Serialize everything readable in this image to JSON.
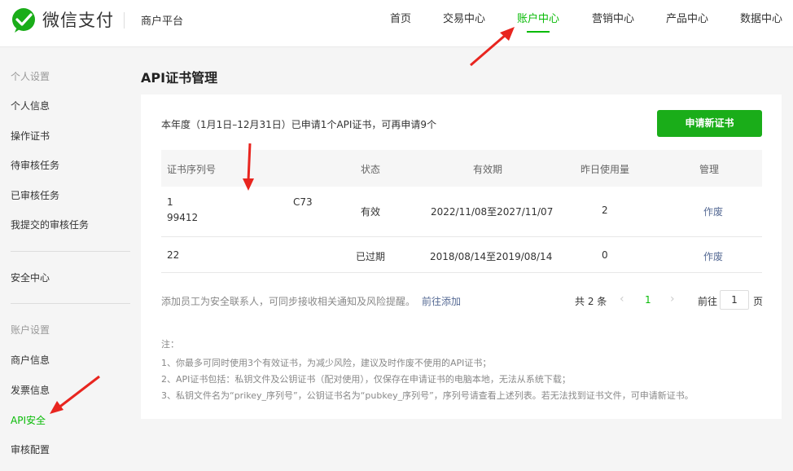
{
  "header": {
    "brand": "微信支付",
    "platform": "商户平台",
    "nav": [
      {
        "label": "首页",
        "active": false
      },
      {
        "label": "交易中心",
        "active": false
      },
      {
        "label": "账户中心",
        "active": true
      },
      {
        "label": "营销中心",
        "active": false
      },
      {
        "label": "产品中心",
        "active": false
      },
      {
        "label": "数据中心",
        "active": false
      }
    ]
  },
  "sidebar": {
    "group1_title": "个人设置",
    "group1_items": [
      "个人信息",
      "操作证书",
      "待审核任务",
      "已审核任务",
      "我提交的审核任务"
    ],
    "security_center": "安全中心",
    "group2_title": "账户设置",
    "group2_items": [
      "商户信息",
      "发票信息",
      "API安全",
      "审核配置"
    ],
    "active_item": "API安全"
  },
  "main": {
    "title": "API证书管理",
    "quota_text": "本年度（1月1日–12月31日）已申请1个API证书，可再申请9个",
    "apply_button": "申请新证书",
    "table": {
      "columns": [
        "证书序列号",
        "状态",
        "有效期",
        "昨日使用量",
        "管理"
      ],
      "rows": [
        {
          "serial_line1": "1",
          "serial_line1_end": "C73",
          "serial_line2": "99412",
          "status": "有效",
          "validity": "2022/11/08至2027/11/07",
          "usage": "2",
          "action": "作废"
        },
        {
          "serial_line1": "22",
          "status": "已过期",
          "validity": "2018/08/14至2019/08/14",
          "usage": "0",
          "action": "作废"
        }
      ]
    },
    "contact_tip": "添加员工为安全联系人，可同步接收相关通知及风险提醒。",
    "contact_link": "前往添加",
    "pagination": {
      "total_text": "共 2 条",
      "prev": "‹",
      "current_page": "1",
      "next": "›",
      "goto_label": "前往",
      "goto_value": "1",
      "goto_suffix": "页"
    },
    "notes": {
      "title": "注：",
      "lines": [
        "1、你最多可同时使用3个有效证书，为减少风险，建议及时作废不使用的API证书；",
        "2、API证书包括：私钥文件及公钥证书（配对使用），仅保存在申请证书的电脑本地，无法从系统下载；",
        "3、私钥文件名为“prikey_序列号”，公钥证书名为“pubkey_序列号”，序列号请查看上述列表。若无法找到证书文件，可申请新证书。"
      ]
    }
  },
  "colors": {
    "accent": "#09bb07",
    "button": "#1aad19",
    "link": "#576b95",
    "annotation_arrow": "#e8251f"
  }
}
